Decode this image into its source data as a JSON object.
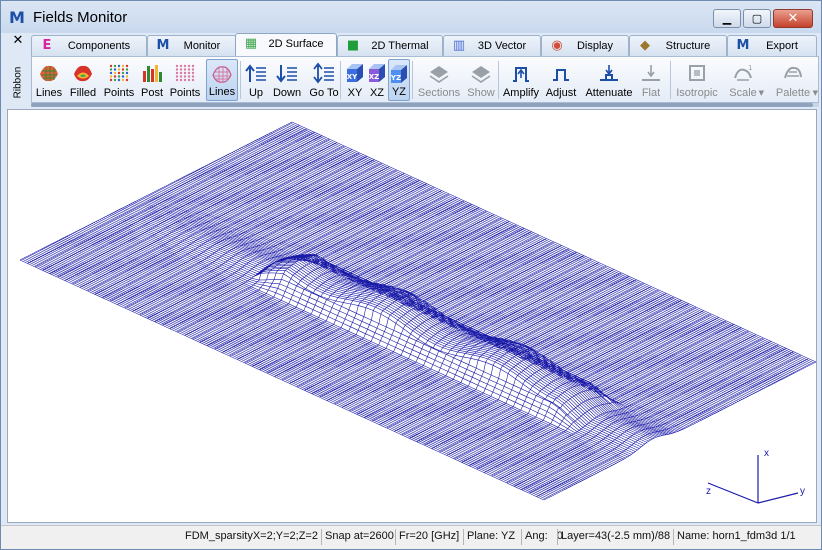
{
  "window": {
    "title": "Fields Monitor",
    "app_icon": "M"
  },
  "ribbon": {
    "label": "Ribbon",
    "close_glyph": "✕"
  },
  "tabs": [
    {
      "label": "Components",
      "icon": "components-icon",
      "glyph": "E",
      "color": "#d6239f"
    },
    {
      "label": "Monitor",
      "icon": "monitor-icon",
      "glyph": "M",
      "color": "#1d4fa8"
    },
    {
      "label": "2D Surface",
      "icon": "surface-2d-icon",
      "glyph": "▦",
      "color": "#3aa34a",
      "active": true
    },
    {
      "label": "2D Thermal",
      "icon": "thermal-2d-icon",
      "glyph": "■",
      "color": "#1f9d3a"
    },
    {
      "label": "3D Vector",
      "icon": "vector-3d-icon",
      "glyph": "▥",
      "color": "#4c6fd8"
    },
    {
      "label": "Display",
      "icon": "display-icon",
      "glyph": "◉",
      "color": "#d14d3a"
    },
    {
      "label": "Structure",
      "icon": "structure-icon",
      "glyph": "◆",
      "color": "#9a7a2a"
    },
    {
      "label": "Export",
      "icon": "export-icon",
      "glyph": "M",
      "color": "#1d4fa8"
    }
  ],
  "toolbar": {
    "buttons": [
      {
        "label": "Lines",
        "icon": "lines-surface-icon"
      },
      {
        "label": "Filled",
        "icon": "filled-surface-icon"
      },
      {
        "label": "Points",
        "icon": "points-surface-icon"
      },
      {
        "label": "Post",
        "icon": "post-bars-icon"
      },
      {
        "label": "Points",
        "icon": "points-pink-icon"
      },
      {
        "label": "Lines",
        "icon": "lines-pink-icon",
        "active": true
      },
      {
        "label": "Up",
        "icon": "layer-up-icon"
      },
      {
        "label": "Down",
        "icon": "layer-down-icon"
      },
      {
        "label": "Go To",
        "icon": "layer-goto-icon"
      },
      {
        "label": "XY",
        "icon": "plane-xy-icon"
      },
      {
        "label": "XZ",
        "icon": "plane-xz-icon"
      },
      {
        "label": "YZ",
        "icon": "plane-yz-icon",
        "active": true
      },
      {
        "label": "Sections",
        "icon": "sections-icon",
        "disabled": true
      },
      {
        "label": "Show",
        "icon": "show-icon",
        "disabled": true
      },
      {
        "label": "Amplify",
        "icon": "amplify-icon"
      },
      {
        "label": "Adjust",
        "icon": "adjust-icon"
      },
      {
        "label": "Attenuate",
        "icon": "attenuate-icon"
      },
      {
        "label": "Flat",
        "icon": "flat-icon",
        "disabled": true
      },
      {
        "label": "Isotropic",
        "icon": "isotropic-icon",
        "disabled": true
      },
      {
        "label": "Scale",
        "icon": "scale-icon",
        "disabled": true,
        "dropdown": true
      },
      {
        "label": "Palette",
        "icon": "palette-icon",
        "disabled": true,
        "dropdown": true
      }
    ]
  },
  "canvas": {
    "mesh_color": "#1a1aa8",
    "axes": {
      "x": "x",
      "y": "y",
      "z": "z",
      "color": "#1a1aa8"
    }
  },
  "status": {
    "sparsity": "FDM_sparsityX=2;Y=2;Z=2",
    "snap": "Snap at=2600",
    "frequency": "Fr=20 [GHz]",
    "plane": "Plane: YZ",
    "angle": "Ang:   0",
    "layer": "Layer=43(-2.5 mm)/88",
    "name": "Name: horn1_fdm3d 1/1"
  },
  "colors": {
    "accent": "#1d4fa8",
    "close": "#c5422c"
  }
}
